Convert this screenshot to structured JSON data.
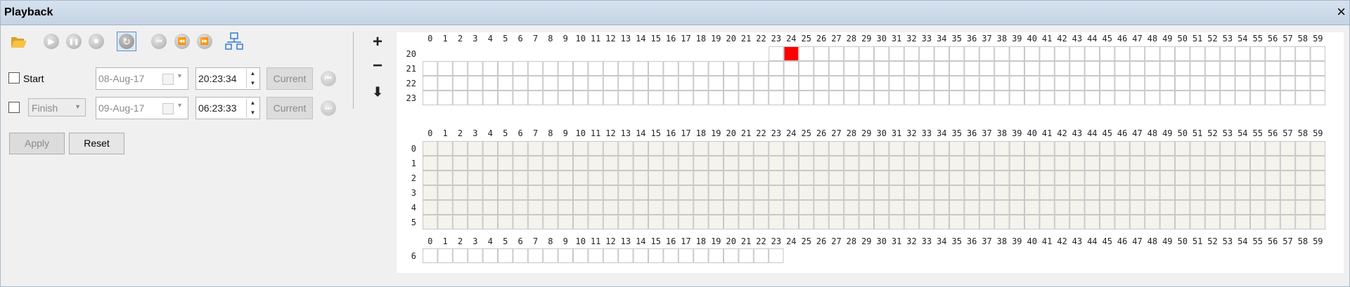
{
  "window": {
    "title": "Playback",
    "close_icon": "×"
  },
  "toolbar": {
    "buttons": [
      {
        "name": "open-folder-icon",
        "glyph": ""
      },
      {
        "name": "play-icon",
        "glyph": "▶"
      },
      {
        "name": "pause-icon",
        "glyph": "❚❚"
      },
      {
        "name": "stop-icon",
        "glyph": "■"
      },
      {
        "name": "loop-icon",
        "glyph": "↻"
      },
      {
        "name": "skip-to-start-icon",
        "glyph": "⏮"
      },
      {
        "name": "rewind-icon",
        "glyph": "⏪"
      },
      {
        "name": "fast-forward-icon",
        "glyph": "⏩"
      },
      {
        "name": "network-icon",
        "glyph": ""
      }
    ]
  },
  "side_tools": {
    "zoom_in": "+",
    "zoom_out": "−",
    "download": "⬇"
  },
  "start": {
    "label": "Start",
    "checked": false,
    "date": "08-Aug-17",
    "time": "20:23:34",
    "current_label": "Current"
  },
  "finish": {
    "mode": "Finish",
    "checked": false,
    "date": "09-Aug-17",
    "time": "06:23:33",
    "current_label": "Current"
  },
  "actions": {
    "apply": "Apply",
    "reset": "Reset"
  },
  "colors": {
    "highlight": "#ff0000",
    "cell_border": "#c8c8c8",
    "cell_fill_empty": "#ffffff",
    "cell_fill_past": "#f4f3ec"
  },
  "timeline": {
    "blocks": [
      {
        "rows": [
          {
            "hour": "20",
            "start_minute": 23,
            "end_minute": 59,
            "fill": "empty"
          },
          {
            "hour": "21",
            "start_minute": 0,
            "end_minute": 59,
            "fill": "empty"
          },
          {
            "hour": "22",
            "start_minute": 0,
            "end_minute": 59,
            "fill": "empty"
          },
          {
            "hour": "23",
            "start_minute": 0,
            "end_minute": 59,
            "fill": "empty"
          }
        ],
        "highlighted": [
          {
            "hour": "20",
            "minute": 24
          }
        ]
      },
      {
        "rows": [
          {
            "hour": "0",
            "start_minute": 0,
            "end_minute": 59,
            "fill": "past"
          },
          {
            "hour": "1",
            "start_minute": 0,
            "end_minute": 59,
            "fill": "past"
          },
          {
            "hour": "2",
            "start_minute": 0,
            "end_minute": 59,
            "fill": "past"
          },
          {
            "hour": "3",
            "start_minute": 0,
            "end_minute": 59,
            "fill": "past"
          },
          {
            "hour": "4",
            "start_minute": 0,
            "end_minute": 59,
            "fill": "past"
          },
          {
            "hour": "5",
            "start_minute": 0,
            "end_minute": 59,
            "fill": "past"
          }
        ],
        "highlighted": []
      },
      {
        "rows": [
          {
            "hour": "6",
            "start_minute": 0,
            "end_minute": 23,
            "fill": "empty"
          }
        ],
        "highlighted": []
      }
    ]
  }
}
